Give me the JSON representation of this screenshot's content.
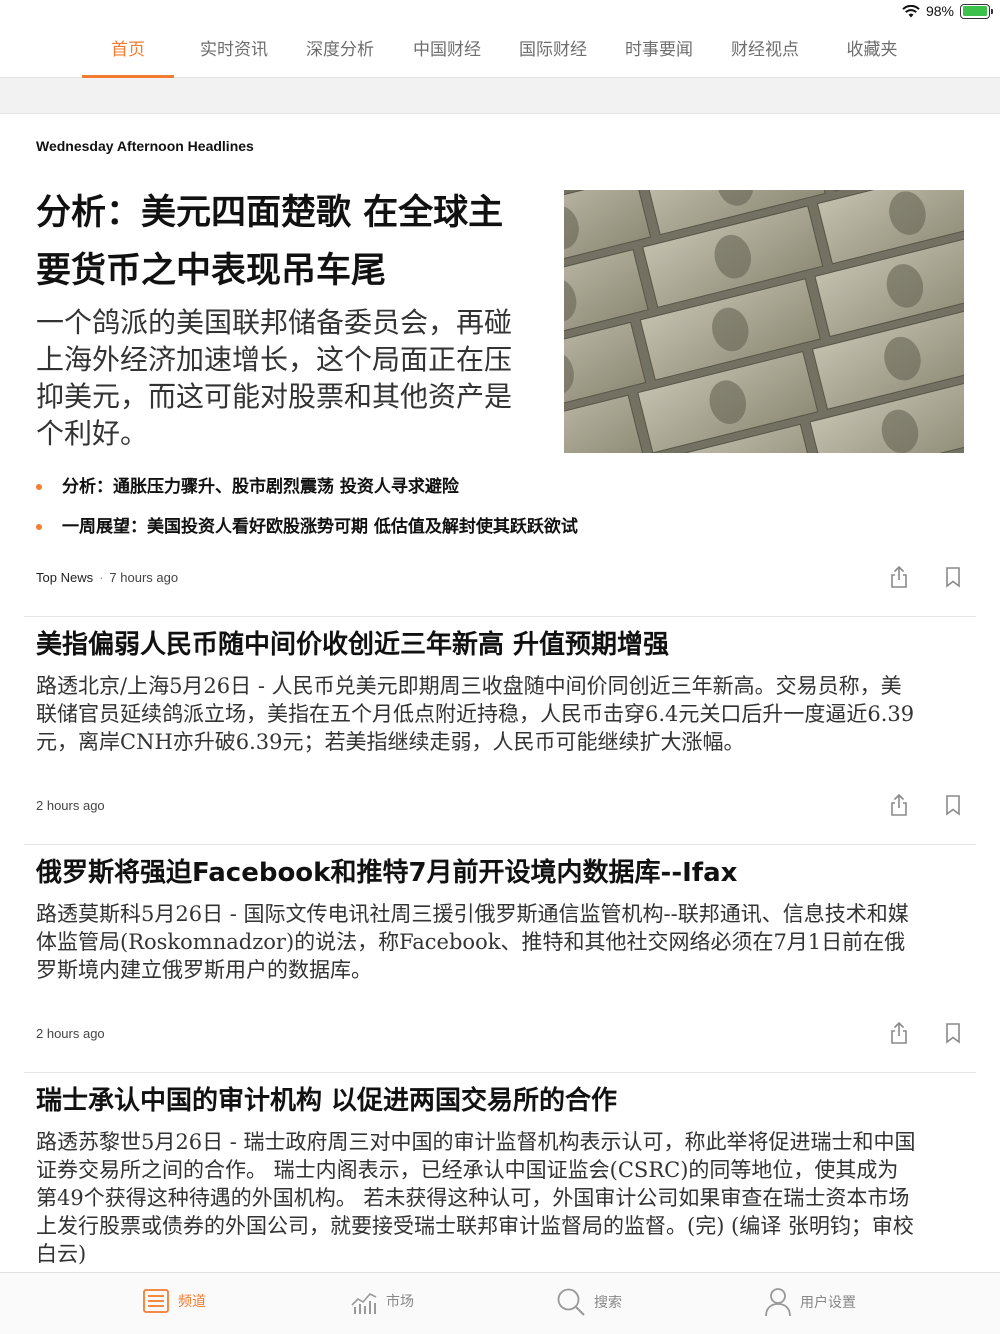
{
  "status": {
    "battery": "98%"
  },
  "top_nav": {
    "tabs": [
      {
        "label": "首页",
        "active": true
      },
      {
        "label": "实时资讯"
      },
      {
        "label": "深度分析"
      },
      {
        "label": "中国财经"
      },
      {
        "label": "国际财经"
      },
      {
        "label": "时事要闻"
      },
      {
        "label": "财经视点"
      },
      {
        "label": "收藏夹"
      }
    ]
  },
  "feed": {
    "section_title": "Wednesday Afternoon Headlines",
    "lead": {
      "title": "分析：美元四面楚歌 在全球主要货币之中表现吊车尾",
      "summary": "一个鸽派的美国联邦储备委员会，再碰上海外经济加速增长，这个局面正在压抑美元，而这可能对股票和其他资产是个利好。",
      "image": "us-dollar-bills",
      "related": [
        "分析：通胀压力骤升、股市剧烈震荡 投资人寻求避险",
        "一周展望：美国投资人看好欧股涨势可期 低估值及解封使其跃跃欲试"
      ],
      "source": "Top News",
      "time": "7 hours ago"
    },
    "stories": [
      {
        "title": "美指偏弱人民币随中间价收创近三年新高 升值预期增强",
        "body": "路透北京/上海5月26日 - 人民币兑美元即期周三收盘随中间价同创近三年新高。交易员称，美联储官员延续鸽派立场，美指在五个月低点附近持稳，人民币击穿6.4元关口后升一度逼近6.39元，离岸CNH亦升破6.39元；若美指继续走弱，人民币可能继续扩大涨幅。",
        "time": "2 hours ago"
      },
      {
        "title": "俄罗斯将强迫Facebook和推特7月前开设境内数据库--Ifax",
        "body": "路透莫斯科5月26日 - 国际文传电讯社周三援引俄罗斯通信监管机构--联邦通讯、信息技术和媒体监管局(Roskomnadzor)的说法，称Facebook、推特和其他社交网络必须在7月1日前在俄罗斯境内建立俄罗斯用户的数据库。",
        "time": "2 hours ago"
      },
      {
        "title": "瑞士承认中国的审计机构 以促进两国交易所的合作",
        "body": "路透苏黎世5月26日 - 瑞士政府周三对中国的审计监督机构表示认可，称此举将促进瑞士和中国证券交易所之间的合作。 瑞士内阁表示，已经承认中国证监会(CSRC)的同等地位，使其成为第49个获得这种待遇的外国机构。 若未获得这种认可，外国审计公司如果审查在瑞士资本市场上发行股票或债券的外国公司，就要接受瑞士联邦审计监督局的监督。(完) (编译 张明钧；审校 白云)"
      }
    ]
  },
  "bottom_nav": {
    "items": [
      {
        "label": "频道",
        "icon": "newspaper-icon",
        "active": true
      },
      {
        "label": "市场",
        "icon": "market-chart-icon"
      },
      {
        "label": "搜索",
        "icon": "search-icon"
      },
      {
        "label": "用户设置",
        "icon": "user-icon"
      }
    ]
  },
  "colors": {
    "accent": "#f47b30",
    "divider": "#e4e4e4"
  }
}
